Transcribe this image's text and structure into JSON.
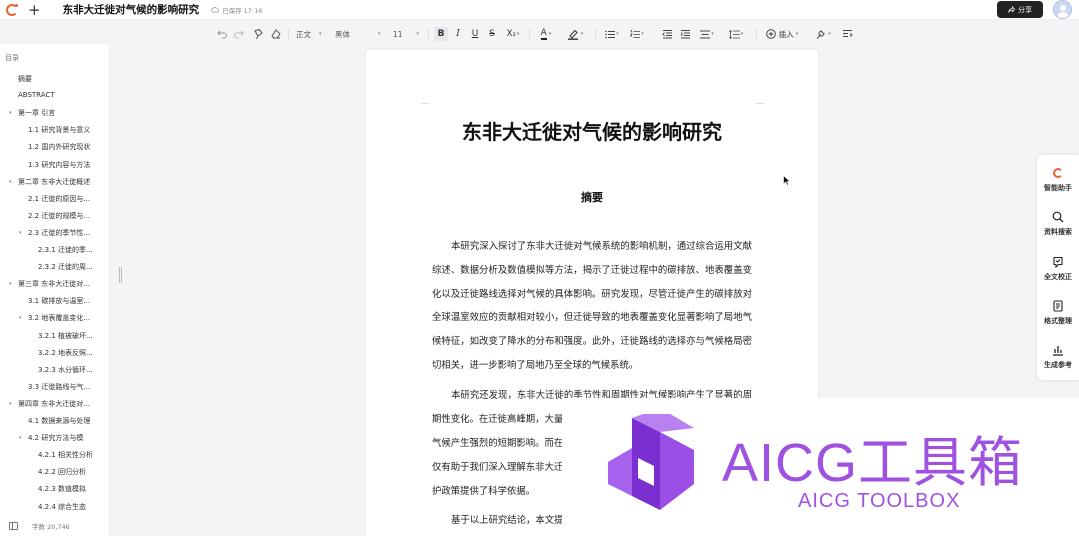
{
  "header": {
    "doc_title": "东非大迁徙对气候的影响研究",
    "save_status": "已保存 17:16",
    "share_label": "分享"
  },
  "toolbar": {
    "style_select": "正文",
    "font_select": "黑体",
    "size_select": "11",
    "insert_label": "插入"
  },
  "sidebar": {
    "toc_heading": "目录",
    "items": [
      {
        "label": "摘要",
        "level": 1
      },
      {
        "label": "ABSTRACT",
        "level": 1
      },
      {
        "label": "第一章 引言",
        "level": 1
      },
      {
        "label": "1.1 研究背景与意义",
        "level": 2
      },
      {
        "label": "1.2 国内外研究现状",
        "level": 2
      },
      {
        "label": "1.3 研究内容与方法",
        "level": 2
      },
      {
        "label": "第二章 东非大迁徙概述",
        "level": 1
      },
      {
        "label": "2.1 迁徙的原因与...",
        "level": 2
      },
      {
        "label": "2.2 迁徙的规模与...",
        "level": 2
      },
      {
        "label": "2.3 迁徙的季节性...",
        "level": 2
      },
      {
        "label": "2.3.1 迁徙的季...",
        "level": 3
      },
      {
        "label": "2.3.2 迁徙的周...",
        "level": 3
      },
      {
        "label": "第三章 东非大迁徙对...",
        "level": 1
      },
      {
        "label": "3.1 碳排放与温室...",
        "level": 2
      },
      {
        "label": "3.2 地表覆盖变化...",
        "level": 2
      },
      {
        "label": "3.2.1 植被破坏...",
        "level": 3
      },
      {
        "label": "3.2.2 地表反照...",
        "level": 3
      },
      {
        "label": "3.2.3 水分循环...",
        "level": 3
      },
      {
        "label": "3.3 迁徙路线与气...",
        "level": 2
      },
      {
        "label": "第四章 东非大迁徙对...",
        "level": 1
      },
      {
        "label": "4.1 数据来源与处理",
        "level": 2
      },
      {
        "label": "4.2 研究方法与模",
        "level": 2
      },
      {
        "label": "4.2.1 相关性分析",
        "level": 3
      },
      {
        "label": "4.2.2 回归分析",
        "level": 3
      },
      {
        "label": "4.2.3 数值模拟",
        "level": 3
      },
      {
        "label": "4.2.4 综合生态",
        "level": 3
      }
    ],
    "word_count": "字数 20,746"
  },
  "document": {
    "title": "东非大迁徙对气候的影响研究",
    "abstract_heading": "摘要",
    "para1": "本研究深入探讨了东非大迁徙对气候系统的影响机制，通过综合运用文献综述、数据分析及数值模拟等方法，揭示了迁徙过程中的碳排放、地表覆盖变化以及迁徙路线选择对气候的具体影响。研究发现，尽管迁徙产生的碳排放对全球温室效应的贡献相对较小，但迁徙导致的地表覆盖变化显著影响了局地气候特征，如改变了降水的分布和强度。此外，迁徙路线的选择亦与气候格局密切相关，进一步影响了局地乃至全球的气候系统。",
    "para2": "本研究还发现，东非大迁徙的季节性和周期性对气候影响产生了显著的周期性变化。在迁徙高峰期，大量",
    "para2_lines": [
      "气候产生强烈的短期影响。而在",
      "仅有助于我们深入理解东非大迁",
      "护政策提供了科学依据。"
    ],
    "para3": "基于以上研究结论，本文提"
  },
  "rail": {
    "items": [
      {
        "label": "智能助手",
        "icon": "assistant-icon"
      },
      {
        "label": "资料搜索",
        "icon": "search-icon"
      },
      {
        "label": "全文校正",
        "icon": "proofread-icon"
      },
      {
        "label": "格式整理",
        "icon": "format-icon"
      },
      {
        "label": "生成参考",
        "icon": "reference-icon"
      }
    ]
  },
  "banner": {
    "title": "AICG工具箱",
    "subtitle": "AICG TOOLBOX",
    "color": "#9f52e0"
  }
}
